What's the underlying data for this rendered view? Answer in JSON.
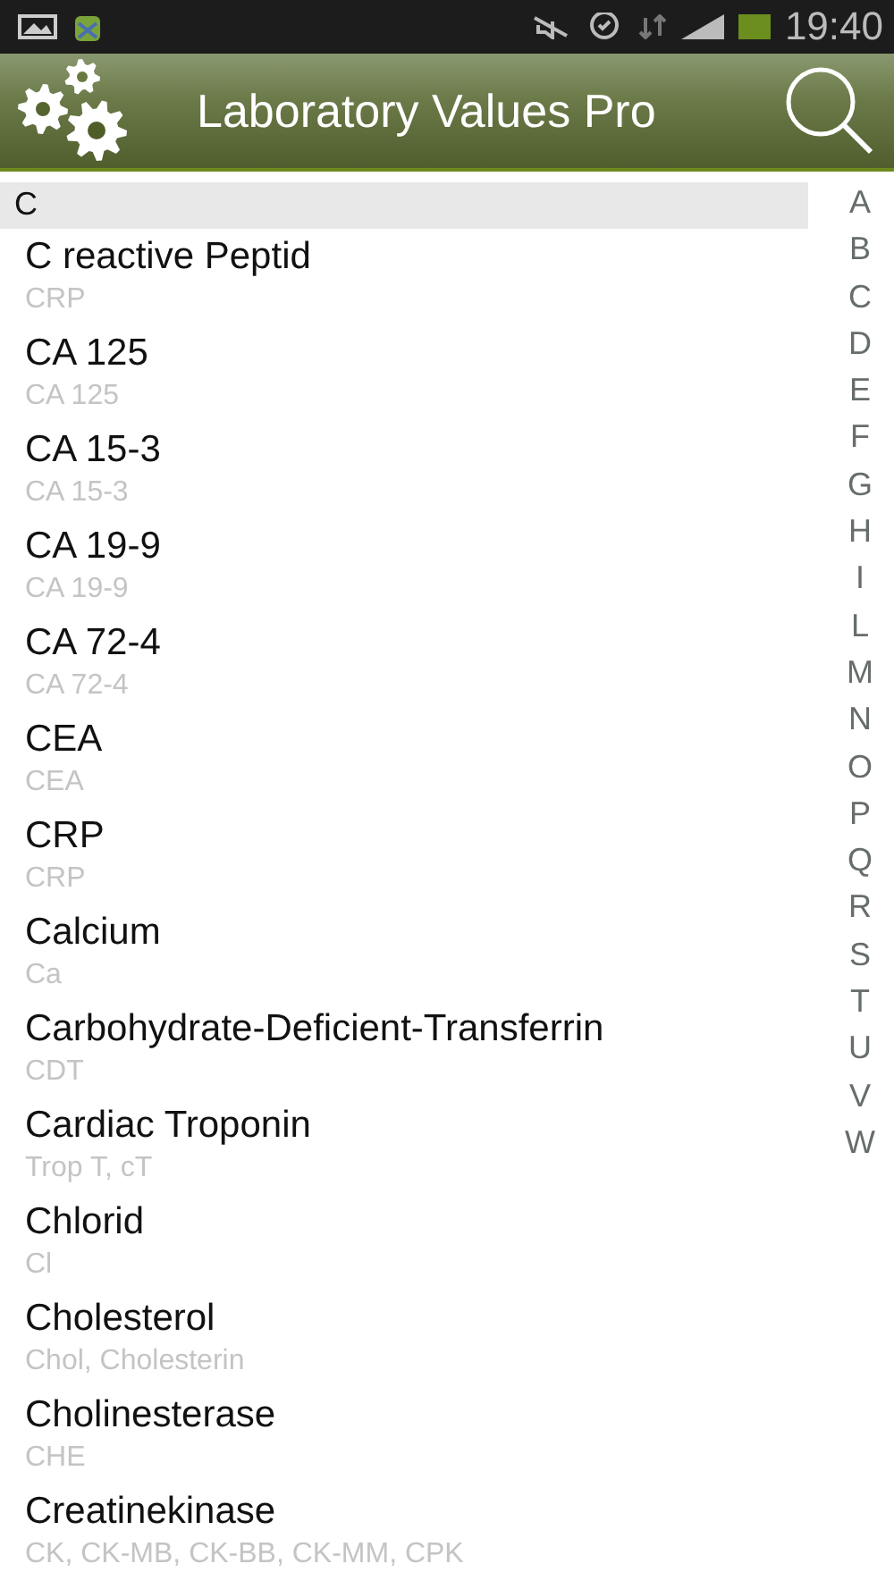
{
  "status_bar": {
    "time": "19:40"
  },
  "app_bar": {
    "title": "Laboratory Values Pro"
  },
  "section": {
    "header": "C"
  },
  "items": [
    {
      "name": "C reactive Peptid",
      "abbr": "CRP"
    },
    {
      "name": "CA 125",
      "abbr": "CA 125"
    },
    {
      "name": "CA 15-3",
      "abbr": "CA 15-3"
    },
    {
      "name": "CA 19-9",
      "abbr": "CA 19-9"
    },
    {
      "name": "CA 72-4",
      "abbr": "CA 72-4"
    },
    {
      "name": "CEA",
      "abbr": "CEA"
    },
    {
      "name": "CRP",
      "abbr": "CRP"
    },
    {
      "name": "Calcium",
      "abbr": "Ca"
    },
    {
      "name": "Carbohydrate-Deficient-Transferrin",
      "abbr": "CDT"
    },
    {
      "name": "Cardiac Troponin",
      "abbr": "Trop T, cT"
    },
    {
      "name": "Chlorid",
      "abbr": "Cl"
    },
    {
      "name": "Cholesterol",
      "abbr": "Chol, Cholesterin"
    },
    {
      "name": "Cholinesterase",
      "abbr": "CHE"
    },
    {
      "name": "Creatinekinase",
      "abbr": "CK, CK-MB, CK-BB, CK-MM, CPK"
    }
  ],
  "index": [
    "A",
    "B",
    "C",
    "D",
    "E",
    "F",
    "G",
    "H",
    "I",
    "L",
    "M",
    "N",
    "O",
    "P",
    "Q",
    "R",
    "S",
    "T",
    "U",
    "V",
    "W"
  ]
}
